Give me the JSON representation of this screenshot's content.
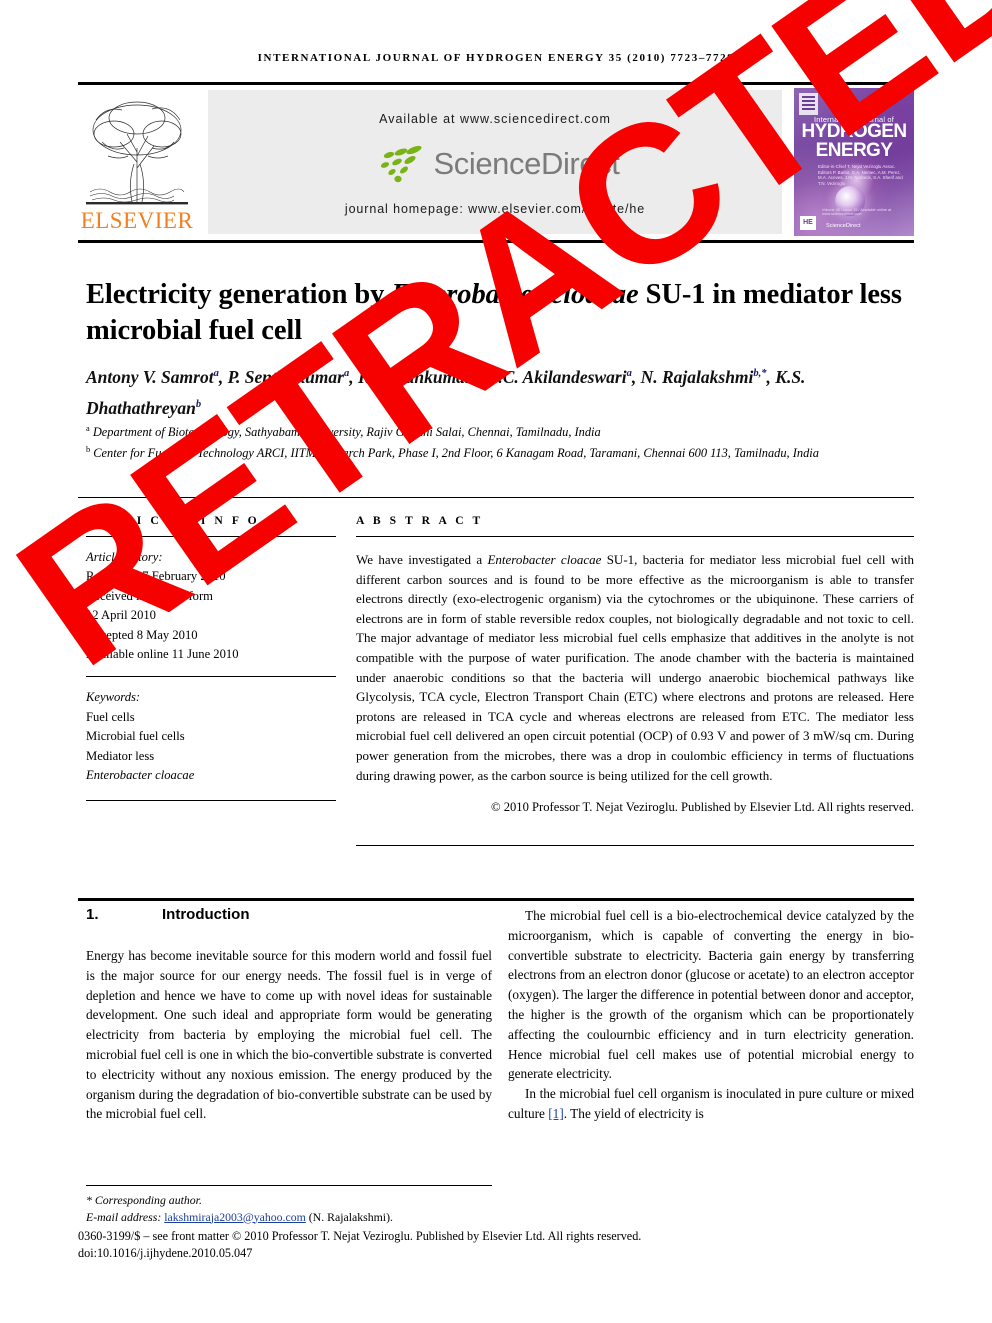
{
  "running_head": "INTERNATIONAL JOURNAL OF HYDROGEN ENERGY 35 (2010) 7723–7729",
  "masthead": {
    "publisher": "ELSEVIER",
    "available_at": "Available at www.sciencedirect.com",
    "sciencedirect": "ScienceDirect",
    "homepage": "journal homepage: www.elsevier.com/locate/he",
    "cover": {
      "line1": "International Journal of",
      "line2": "HYDROGEN",
      "line3": "ENERGY",
      "editors": "Editor-in-Chief  T. Nejat Veziroglu\nAssoc. Editors  P. Barbir, G.A. Nemec, A.M. Perez, M.A. Aceves, J.M. Norbeck, S.A. Sherif and T.N. Veziroglu",
      "badge": "HE",
      "sciencedirect": "ScienceDirect",
      "footer_line": "Volume 35 / Issue 15 / Available online at www.sciencedirect.com"
    }
  },
  "title_parts": {
    "before": "Electricity generation by ",
    "italic": "Enterobacter cloacae",
    "after": " SU-1 in mediator less microbial fuel cell"
  },
  "authors": [
    {
      "name": "Antony V. Samrot",
      "sup": "a",
      "sep": ", "
    },
    {
      "name": "P. Senthilkumar",
      "sup": "a",
      "sep": ", "
    },
    {
      "name": "K. Pavankumar",
      "sup": "a",
      "sep": ", "
    },
    {
      "name": "G.C. Akilandeswari",
      "sup": "a",
      "sep": ", "
    },
    {
      "name": "N. Rajalakshmi",
      "sup": "b,*",
      "sep": ", "
    },
    {
      "name": "K.S. Dhathathreyan",
      "sup": "b",
      "sep": ""
    }
  ],
  "affiliations": [
    {
      "sup": "a",
      "text": "Department of Biotechnology, Sathyabama University, Rajiv Gandhi Salai, Chennai, Tamilnadu, India"
    },
    {
      "sup": "b",
      "text": "Center for Fuel Cell Technology ARCI, IITM Research Park, Phase I, 2nd Floor, 6 Kanagam Road, Taramani, Chennai 600 113, Tamilnadu, India"
    }
  ],
  "article_info": {
    "label": "A R T I C L E   I N F O",
    "history_label": "Article history:",
    "history": [
      "Received 27 February 2010",
      "Received in revised form",
      "12 April 2010",
      "Accepted 8 May 2010",
      "Available online 11 June 2010"
    ],
    "keywords_label": "Keywords:",
    "keywords": [
      {
        "text": "Fuel cells",
        "italic": false
      },
      {
        "text": "Microbial fuel cells",
        "italic": false
      },
      {
        "text": "Mediator less",
        "italic": false
      },
      {
        "text": "Enterobacter cloacae",
        "italic": true
      }
    ]
  },
  "abstract": {
    "label": "A B S T R A C T",
    "text_before_italic": "We have investigated a ",
    "italic_term": "Enterobacter cloacae",
    "text_after_italic": " SU-1, bacteria for mediator less microbial fuel cell with different carbon sources and is found to be more effective as the microorganism is able to transfer electrons directly (exo-electrogenic organism) via the cytochromes or the ubiquinone. These carriers of electrons are in form of stable reversible redox couples, not biologically degradable and not toxic to cell. The major advantage of mediator less microbial fuel cells emphasize that additives in the anolyte is not compatible with the purpose of water purification. The anode chamber with the bacteria is maintained under anaerobic conditions so that the bacteria will undergo anaerobic biochemical pathways like Glycolysis, TCA cycle, Electron Transport Chain (ETC) where electrons and protons are released. Here protons are released in TCA cycle and whereas electrons are released from ETC. The mediator less microbial fuel cell delivered an open circuit potential (OCP) of 0.93 V and power of 3 mW/sq cm. During power generation from the microbes, there was a drop in coulombic efficiency in terms of fluctuations during drawing power, as the carbon source is being utilized for the cell growth.",
    "copyright": "© 2010 Professor T. Nejat Veziroglu. Published by Elsevier Ltd. All rights reserved."
  },
  "section": {
    "number": "1.",
    "title": "Introduction"
  },
  "body_left": "Energy has become inevitable source for this modern world and fossil fuel is the major source for our energy needs. The fossil fuel is in verge of depletion and hence we have to come up with novel ideas for sustainable development. One such ideal and appropriate form would be generating electricity from bacteria by employing the microbial fuel cell. The microbial fuel cell is one in which the bio-convertible substrate is converted to electricity without any noxious emission. The energy produced by the organism during the degradation of bio-convertible substrate can be used by the microbial fuel cell.",
  "body_right_p1": "The microbial fuel cell is a bio-electrochemical device catalyzed by the microorganism, which is capable of converting the energy in bio-convertible substrate to electricity. Bacteria gain energy by transferring electrons from an electron donor (glucose or acetate) to an electron acceptor (oxygen). The larger the difference in potential between donor and acceptor, the higher is the growth of the organism which can be proportionately affecting the coulournbic efficiency and in turn electricity generation. Hence microbial fuel cell makes use of potential microbial energy to generate electricity.",
  "body_right_p2_before": "In the microbial fuel cell organism is inoculated in pure culture or mixed culture ",
  "body_right_p2_ref": "[1]",
  "body_right_p2_after": ". The yield of electricity is",
  "footer": {
    "corresponding": "* Corresponding author.",
    "email_label": "E-mail address: ",
    "email": "lakshmiraja2003@yahoo.com",
    "email_name": " (N. Rajalakshmi).",
    "front_matter": "0360-3199/$ – see front matter © 2010 Professor T. Nejat Veziroglu. Published by Elsevier Ltd. All rights reserved.",
    "doi": "doi:10.1016/j.ijhydene.2010.05.047"
  },
  "stamp": {
    "text": "RETRACTED",
    "color": "#f60000"
  }
}
